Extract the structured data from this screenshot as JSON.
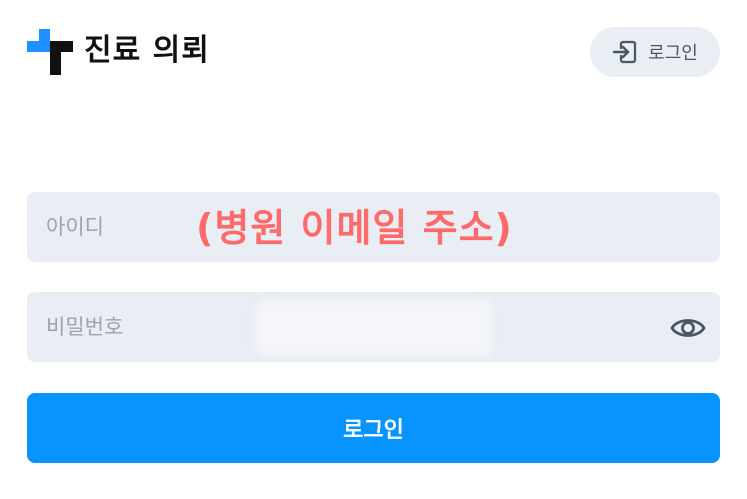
{
  "header": {
    "title": "진료 의뢰",
    "logo_icon": "medical-cross-logo",
    "login_button_label": "로그인",
    "login_button_icon": "sign-in-icon"
  },
  "form": {
    "id_field": {
      "placeholder": "아이디",
      "value": ""
    },
    "id_hint": "(병원 이메일 주소)",
    "password_field": {
      "placeholder": "비밀번호",
      "value": "",
      "toggle_icon": "eye-icon"
    },
    "submit_label": "로그인"
  },
  "colors": {
    "primary": "#0894ff",
    "logo_blue": "#1e90ff",
    "logo_dark": "#111111",
    "field_background": "#e9edf4",
    "hint_red": "#ff6b6b"
  }
}
